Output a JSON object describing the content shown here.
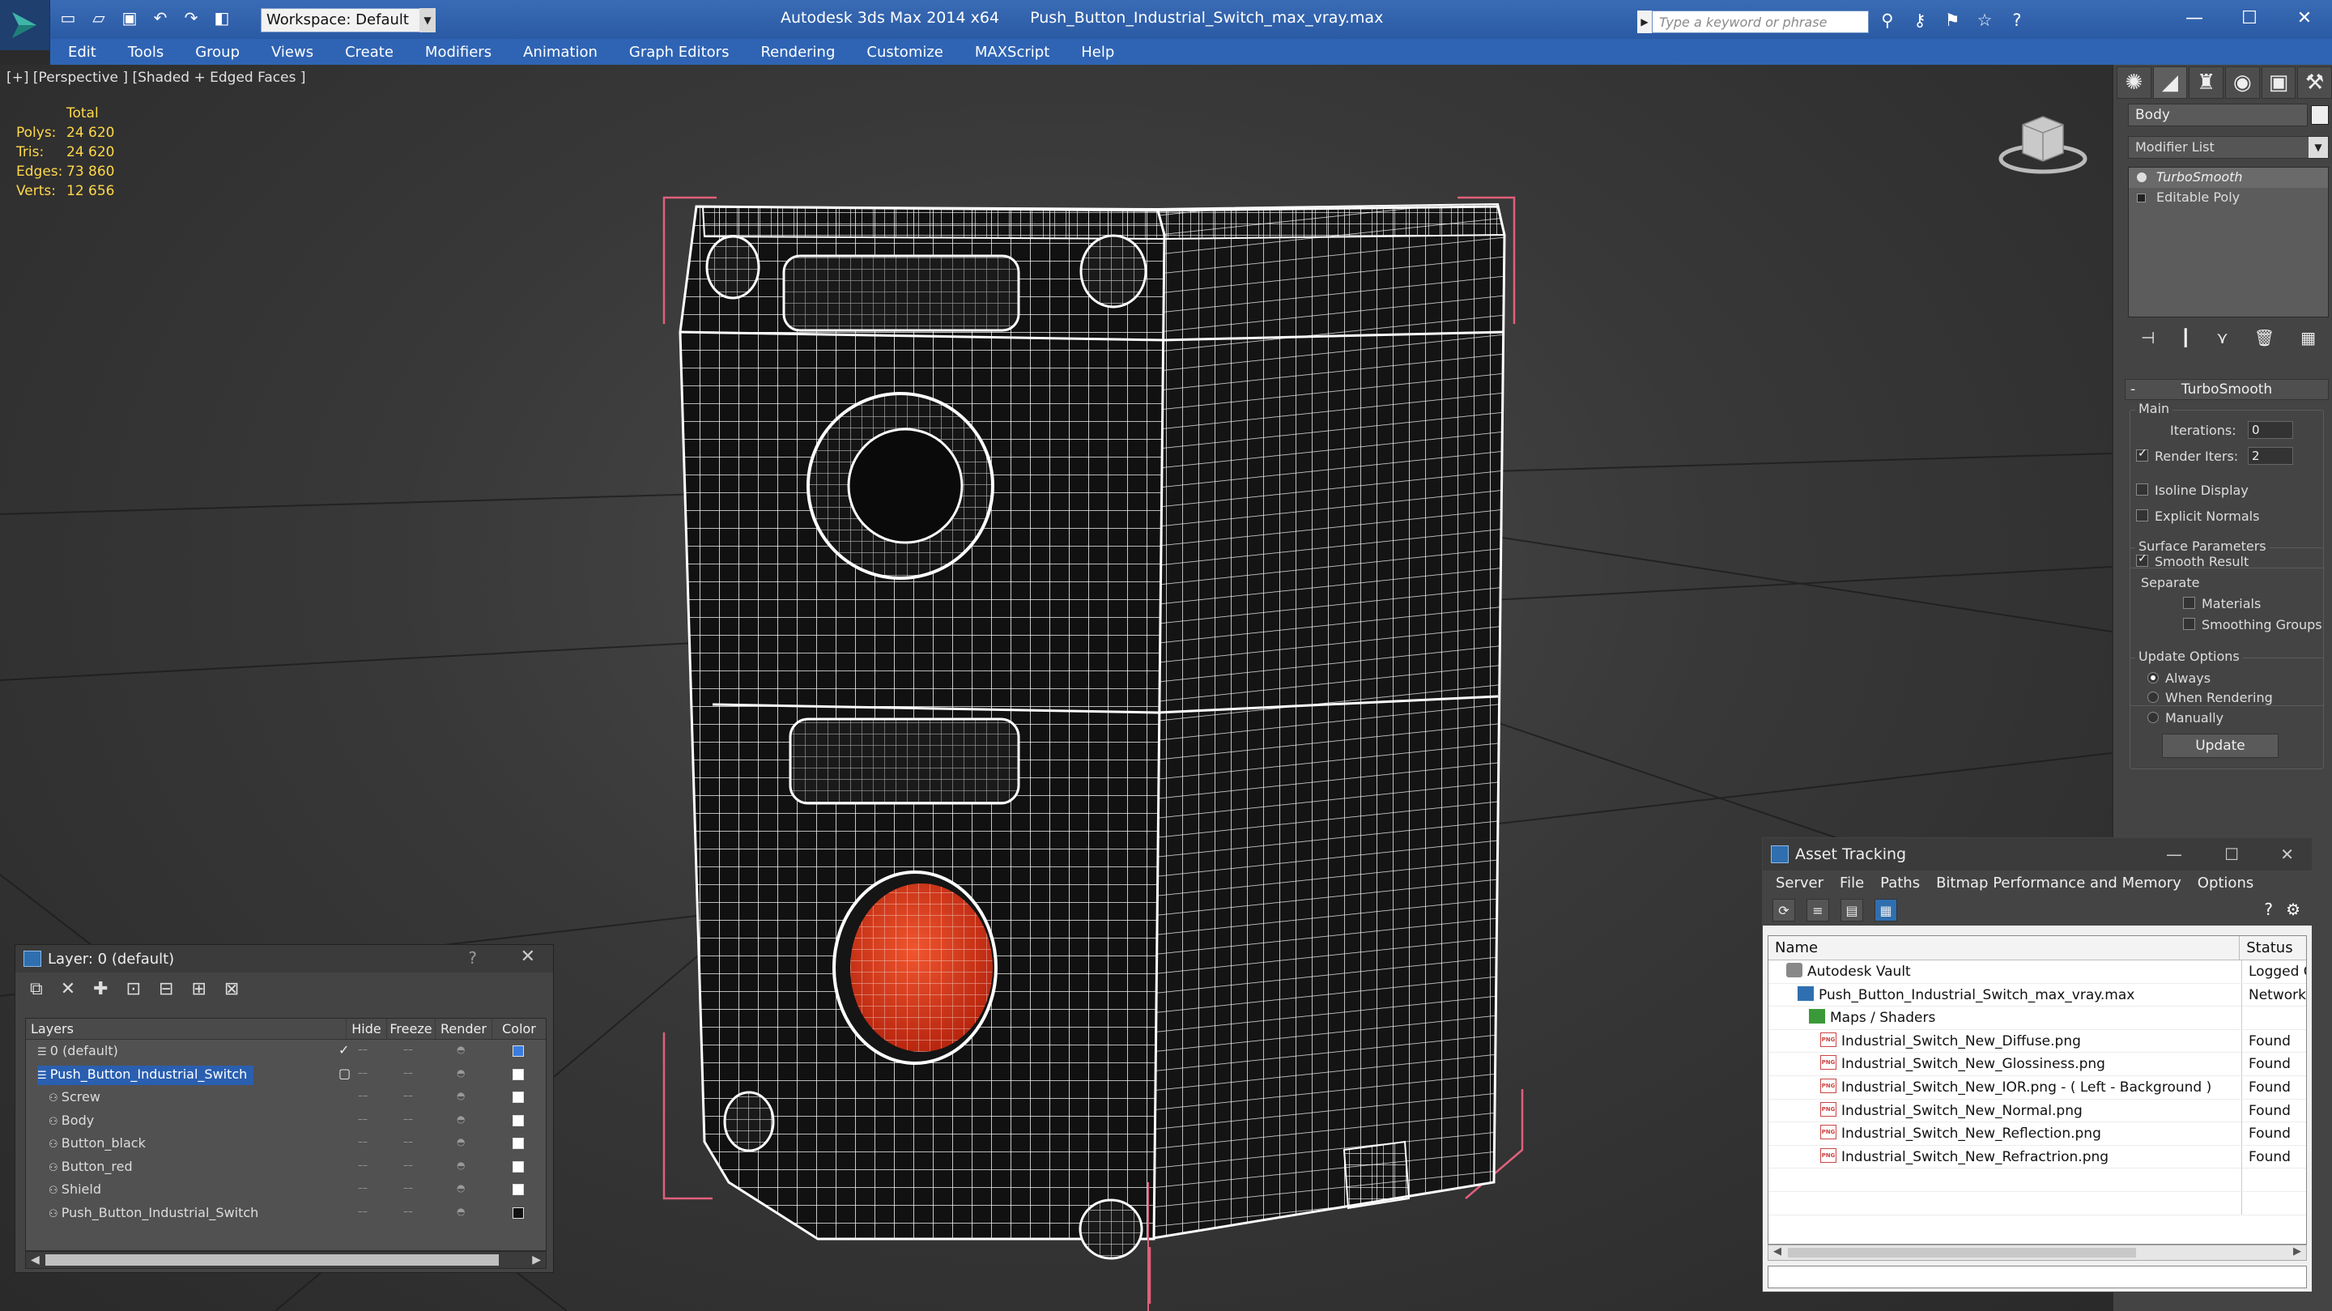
{
  "titlebar": {
    "workspace": "Workspace: Default",
    "app_name": "Autodesk 3ds Max  2014 x64",
    "file_name": "Push_Button_Industrial_Switch_max_vray.max",
    "search_placeholder": "Type a keyword or phrase"
  },
  "menu": [
    "Edit",
    "Tools",
    "Group",
    "Views",
    "Create",
    "Modifiers",
    "Animation",
    "Graph Editors",
    "Rendering",
    "Customize",
    "MAXScript",
    "Help"
  ],
  "viewport": {
    "label": "[+] [Perspective ] [Shaded + Edged Faces ]",
    "stats": {
      "header": "Total",
      "rows": [
        {
          "k": "Polys:",
          "v": "24 620"
        },
        {
          "k": "Tris:",
          "v": "24 620"
        },
        {
          "k": "Edges:",
          "v": "73 860"
        },
        {
          "k": "Verts:",
          "v": "12 656"
        }
      ]
    }
  },
  "command_panel": {
    "object_name": "Body",
    "modifier_list": "Modifier List",
    "stack": [
      "TurboSmooth",
      "Editable Poly"
    ],
    "rollout_title": "TurboSmooth",
    "main_group": "Main",
    "iterations_label": "Iterations:",
    "iterations_value": "0",
    "render_iters_label": "Render Iters:",
    "render_iters_value": "2",
    "isoline": "Isoline Display",
    "explicit_normals": "Explicit Normals",
    "surface_group": "Surface Parameters",
    "smooth_result": "Smooth Result",
    "separate": "Separate",
    "materials": "Materials",
    "smoothing_groups": "Smoothing Groups",
    "update_group": "Update Options",
    "always": "Always",
    "when_rendering": "When Rendering",
    "manually": "Manually",
    "update_button": "Update"
  },
  "layer_window": {
    "title": "Layer: 0 (default)",
    "help": "?",
    "columns": [
      "Layers",
      "Hide",
      "Freeze",
      "Render",
      "Color"
    ],
    "rows": [
      {
        "name": "0 (default)",
        "indent": 1,
        "color": "#3a7de0",
        "sel": false
      },
      {
        "name": "Push_Button_Industrial_Switch",
        "indent": 1,
        "color": "#ffffff",
        "sel": true
      },
      {
        "name": "Screw",
        "indent": 2,
        "color": "#ffffff",
        "sel": false
      },
      {
        "name": "Body",
        "indent": 2,
        "color": "#ffffff",
        "sel": false
      },
      {
        "name": "Button_black",
        "indent": 2,
        "color": "#ffffff",
        "sel": false
      },
      {
        "name": "Button_red",
        "indent": 2,
        "color": "#ffffff",
        "sel": false
      },
      {
        "name": "Shield",
        "indent": 2,
        "color": "#ffffff",
        "sel": false
      },
      {
        "name": "Push_Button_Industrial_Switch",
        "indent": 2,
        "color": "#111111",
        "sel": false
      }
    ]
  },
  "asset_window": {
    "title": "Asset Tracking",
    "menu": [
      "Server",
      "File",
      "Paths",
      "Bitmap Performance and Memory",
      "Options"
    ],
    "columns": [
      "Name",
      "Status"
    ],
    "rows": [
      {
        "name": "Autodesk Vault",
        "status": "Logged O",
        "indent": 1,
        "icon": "vault"
      },
      {
        "name": "Push_Button_Industrial_Switch_max_vray.max",
        "status": "Network I",
        "indent": 2,
        "icon": "file"
      },
      {
        "name": "Maps / Shaders",
        "status": "",
        "indent": 3,
        "icon": "folder"
      },
      {
        "name": "Industrial_Switch_New_Diffuse.png",
        "status": "Found",
        "indent": 4,
        "icon": "png"
      },
      {
        "name": "Industrial_Switch_New_Glossiness.png",
        "status": "Found",
        "indent": 4,
        "icon": "png"
      },
      {
        "name": "Industrial_Switch_New_IOR.png -  ( Left - Background )",
        "status": "Found",
        "indent": 4,
        "icon": "png"
      },
      {
        "name": "Industrial_Switch_New_Normal.png",
        "status": "Found",
        "indent": 4,
        "icon": "png"
      },
      {
        "name": "Industrial_Switch_New_Reflection.png",
        "status": "Found",
        "indent": 4,
        "icon": "png"
      },
      {
        "name": "Industrial_Switch_New_Refractrion.png",
        "status": "Found",
        "indent": 4,
        "icon": "png"
      }
    ]
  },
  "colors": {
    "title_blue": "#2a5aa4",
    "selection_blue": "#2a5fb0",
    "wire": "#ffffff",
    "button_red": "#d9381e",
    "bbox_pink": "#e0607a",
    "stats_yellow": "#ffd84a"
  }
}
